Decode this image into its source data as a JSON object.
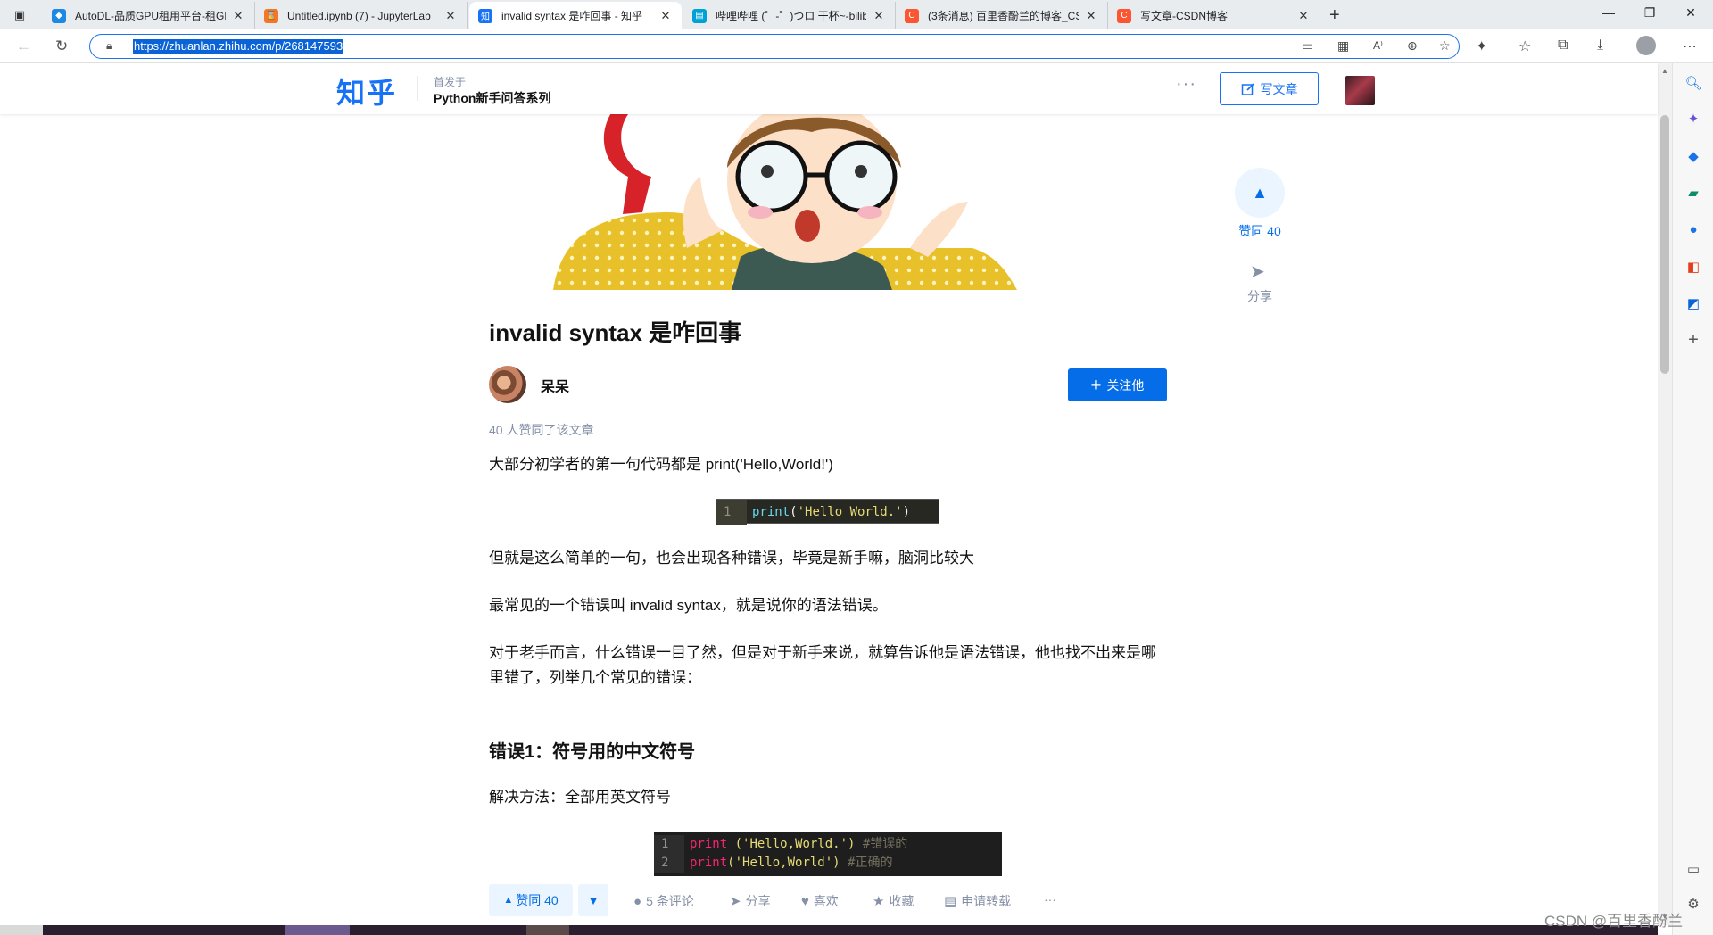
{
  "browser": {
    "tabs": [
      {
        "title": "AutoDL-品质GPU租用平台-租GP",
        "favicon_color": "#1e88e5"
      },
      {
        "title": "Untitled.ipynb (7) - JupyterLab",
        "favicon_color": "#f37726"
      },
      {
        "title": "invalid syntax 是咋回事 - 知乎",
        "favicon_color": "#1772f6",
        "favicon_text": "知"
      },
      {
        "title": "哔哩哔哩 (゜-゜)つロ 干杯~-bilib",
        "favicon_color": "#00a1d6"
      },
      {
        "title": "(3条消息) 百里香酚兰的博客_CSD",
        "favicon_color": "#fc5531",
        "favicon_text": "C"
      },
      {
        "title": "写文章-CSDN博客",
        "favicon_color": "#fc5531",
        "favicon_text": "C"
      }
    ],
    "tab_close_glyph": "✕",
    "new_tab_glyph": "+",
    "window_controls": [
      "—",
      "❐",
      "✕"
    ],
    "url": "https://zhuanlan.zhihu.com/p/268147593"
  },
  "zhihu": {
    "logo": "知乎",
    "first_published_label": "首发于",
    "column_name": "Python新手问答系列",
    "more_glyph": "···",
    "write_label": "写文章"
  },
  "article": {
    "title": "invalid syntax 是咋回事",
    "author": "呆呆",
    "follow_label": "关注他",
    "likes_line": "40 人赞同了该文章",
    "p1": "大部分初学者的第一句代码都是 print('Hello,World!')",
    "code1": {
      "line": "1",
      "fn": "print",
      "open": "(",
      "str": "'Hello World.'",
      "close": ")"
    },
    "p2": "但就是这么简单的一句，也会出现各种错误，毕竟是新手嘛，脑洞比较大",
    "p3": "最常见的一个错误叫 invalid syntax，就是说你的语法错误。",
    "p4": "对于老手而言，什么错误一目了然，但是对于新手来说，就算告诉他是语法错误，他也找不出来是哪里错了，列举几个常见的错误：",
    "h_error1": "错误1：符号用的中文符号",
    "p5": "解决方法：全部用英文符号",
    "code2": [
      {
        "line": "1",
        "fn": "print",
        "rest": " ('Hello,World.')",
        "comment": " #错误的"
      },
      {
        "line": "2",
        "fn": "print",
        "rest": "('Hello,World')",
        "comment": " #正确的"
      }
    ]
  },
  "float_panel": {
    "vote_label": "赞同 40",
    "share_label": "分享"
  },
  "actions": {
    "vote_up": "赞同 40",
    "comments": "5 条评论",
    "share": "分享",
    "like": "喜欢",
    "collect": "收藏",
    "reprint": "申请转载",
    "more": "···"
  },
  "watermark": "CSDN @百里香酚兰",
  "colors": {
    "zhihu_blue": "#1772f6",
    "follow_blue": "#056de8",
    "muted_gray": "#8590a6"
  }
}
